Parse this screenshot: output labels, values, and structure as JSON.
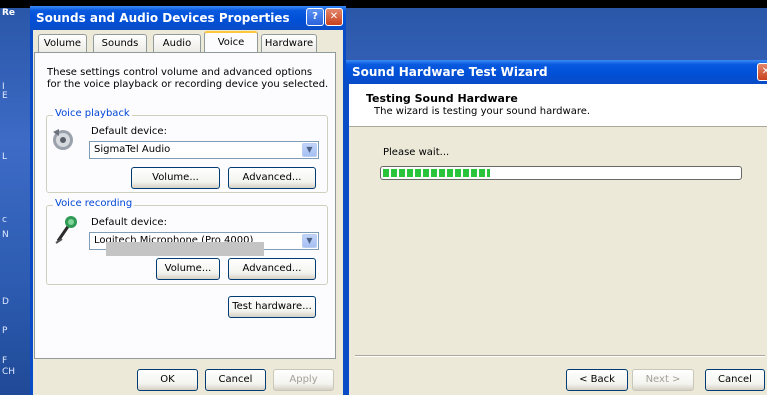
{
  "desktop": {
    "partial_title": "Re",
    "side_text": [
      "I",
      "E",
      "L",
      "c",
      "N",
      "D",
      "P",
      "F",
      "CH"
    ]
  },
  "properties_dialog": {
    "title": "Sounds and Audio Devices Properties",
    "help_button": "?",
    "close_button": "✕",
    "tabs": [
      {
        "label": "Volume"
      },
      {
        "label": "Sounds"
      },
      {
        "label": "Audio"
      },
      {
        "label": "Voice",
        "active": true
      },
      {
        "label": "Hardware"
      }
    ],
    "description": "These settings control volume and advanced options for the voice playback or recording device you selected.",
    "voice_playback": {
      "legend": "Voice playback",
      "device_label": "Default device:",
      "device_value": "SigmaTel Audio",
      "volume_button": "Volume...",
      "advanced_button": "Advanced..."
    },
    "voice_recording": {
      "legend": "Voice recording",
      "device_label": "Default device:",
      "device_value": "Logitech Microphone (Pro 4000)",
      "volume_button": "Volume...",
      "advanced_button": "Advanced..."
    },
    "test_hardware_button": "Test hardware...",
    "ok_button": "OK",
    "cancel_button": "Cancel",
    "apply_button": "Apply"
  },
  "wizard": {
    "title": "Sound Hardware Test Wizard",
    "heading": "Testing Sound Hardware",
    "subheading": "The wizard is testing your sound hardware.",
    "status_text": "Please wait...",
    "progress_fraction": 0.3,
    "back_button": "< Back",
    "next_button": "Next >",
    "cancel_button": "Cancel"
  },
  "colors": {
    "xp_title_blue": "#0050d8",
    "dialog_face": "#ece9d8",
    "progress_green": "#29c43a",
    "legend_blue": "#0046d5"
  }
}
